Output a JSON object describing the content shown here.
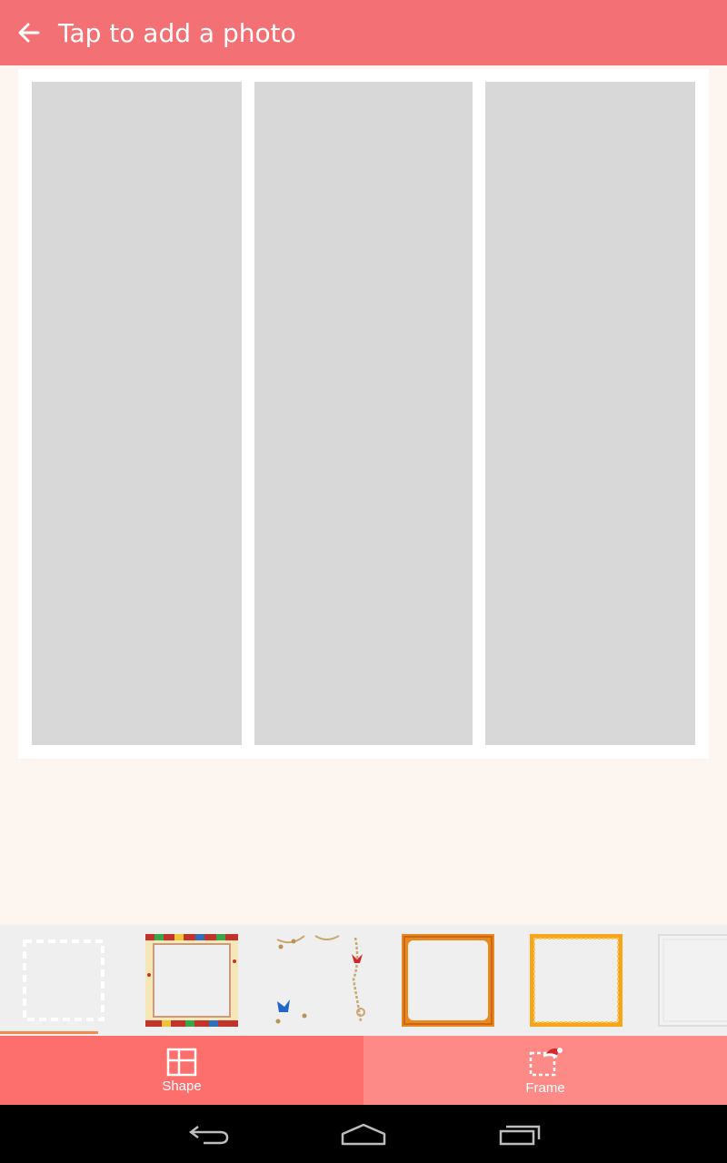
{
  "app_bar": {
    "title": "Tap to add a photo",
    "back_icon": "arrow-left-icon",
    "color": "#f37074"
  },
  "collage": {
    "layout": "three-vertical-columns",
    "cells": [
      {
        "name": "photo-slot-1",
        "fill": "#d8d8d8"
      },
      {
        "name": "photo-slot-2",
        "fill": "#d8d8d8"
      },
      {
        "name": "photo-slot-3",
        "fill": "#d8d8d8"
      }
    ]
  },
  "frame_options": [
    {
      "name": "no-frame",
      "icon": "dashed-square-icon",
      "selected": true
    },
    {
      "name": "colorful-border-frame",
      "icon": "colorful-frame-icon",
      "selected": false
    },
    {
      "name": "gold-chain-ribbon-frame",
      "icon": "ribbon-chain-frame-icon",
      "selected": false
    },
    {
      "name": "orange-rough-frame",
      "icon": "orange-frame-icon",
      "selected": false
    },
    {
      "name": "orange-wavy-frame",
      "icon": "wavy-orange-frame-icon",
      "selected": false
    },
    {
      "name": "light-gray-frame",
      "icon": "gray-frame-icon",
      "selected": false
    }
  ],
  "bottom_tabs": [
    {
      "label": "Shape",
      "icon": "grid-icon",
      "active": true,
      "color": "#fc6f6c"
    },
    {
      "label": "Frame",
      "icon": "santa-hat-frame-icon",
      "active": false,
      "color": "#fe8a87"
    }
  ],
  "system_nav": {
    "back_icon": "back-icon",
    "home_icon": "home-icon",
    "recents_icon": "recents-icon"
  },
  "colors": {
    "accent": "#f58a4b",
    "background": "#fdf5ef",
    "strip": "#efefef"
  }
}
